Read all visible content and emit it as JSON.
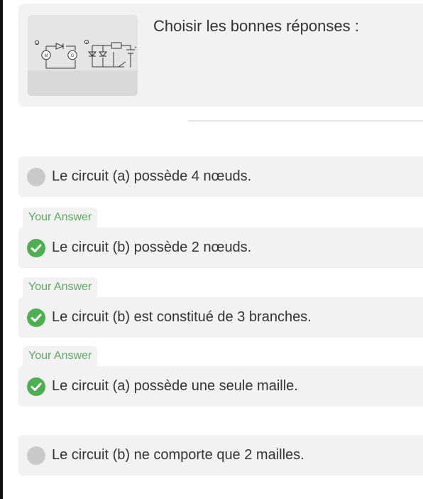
{
  "question": {
    "prompt": "Choisir les bonnes réponses :",
    "image": {
      "circuit_a_label": "a",
      "circuit_b_label": "b",
      "motor_label": "M",
      "generator_label": "G",
      "plus_sign": "+"
    }
  },
  "your_answer_label": "Your Answer",
  "options": [
    {
      "label": "Le circuit (a) possède 4 nœuds.",
      "selected": false
    },
    {
      "label": "Le circuit (b) possède 2 nœuds.",
      "selected": true
    },
    {
      "label": "Le circuit (b) est constitué de 3 branches.",
      "selected": true
    },
    {
      "label": "Le circuit (a) possède une seule maille.",
      "selected": true
    },
    {
      "label": "Le circuit (b) ne comporte que 2 mailles.",
      "selected": false
    }
  ],
  "colors": {
    "selected": "#4caf50",
    "unselected": "#c9c9c9",
    "badge_text": "#5aad5e",
    "card_background": "#f2f2f2"
  }
}
